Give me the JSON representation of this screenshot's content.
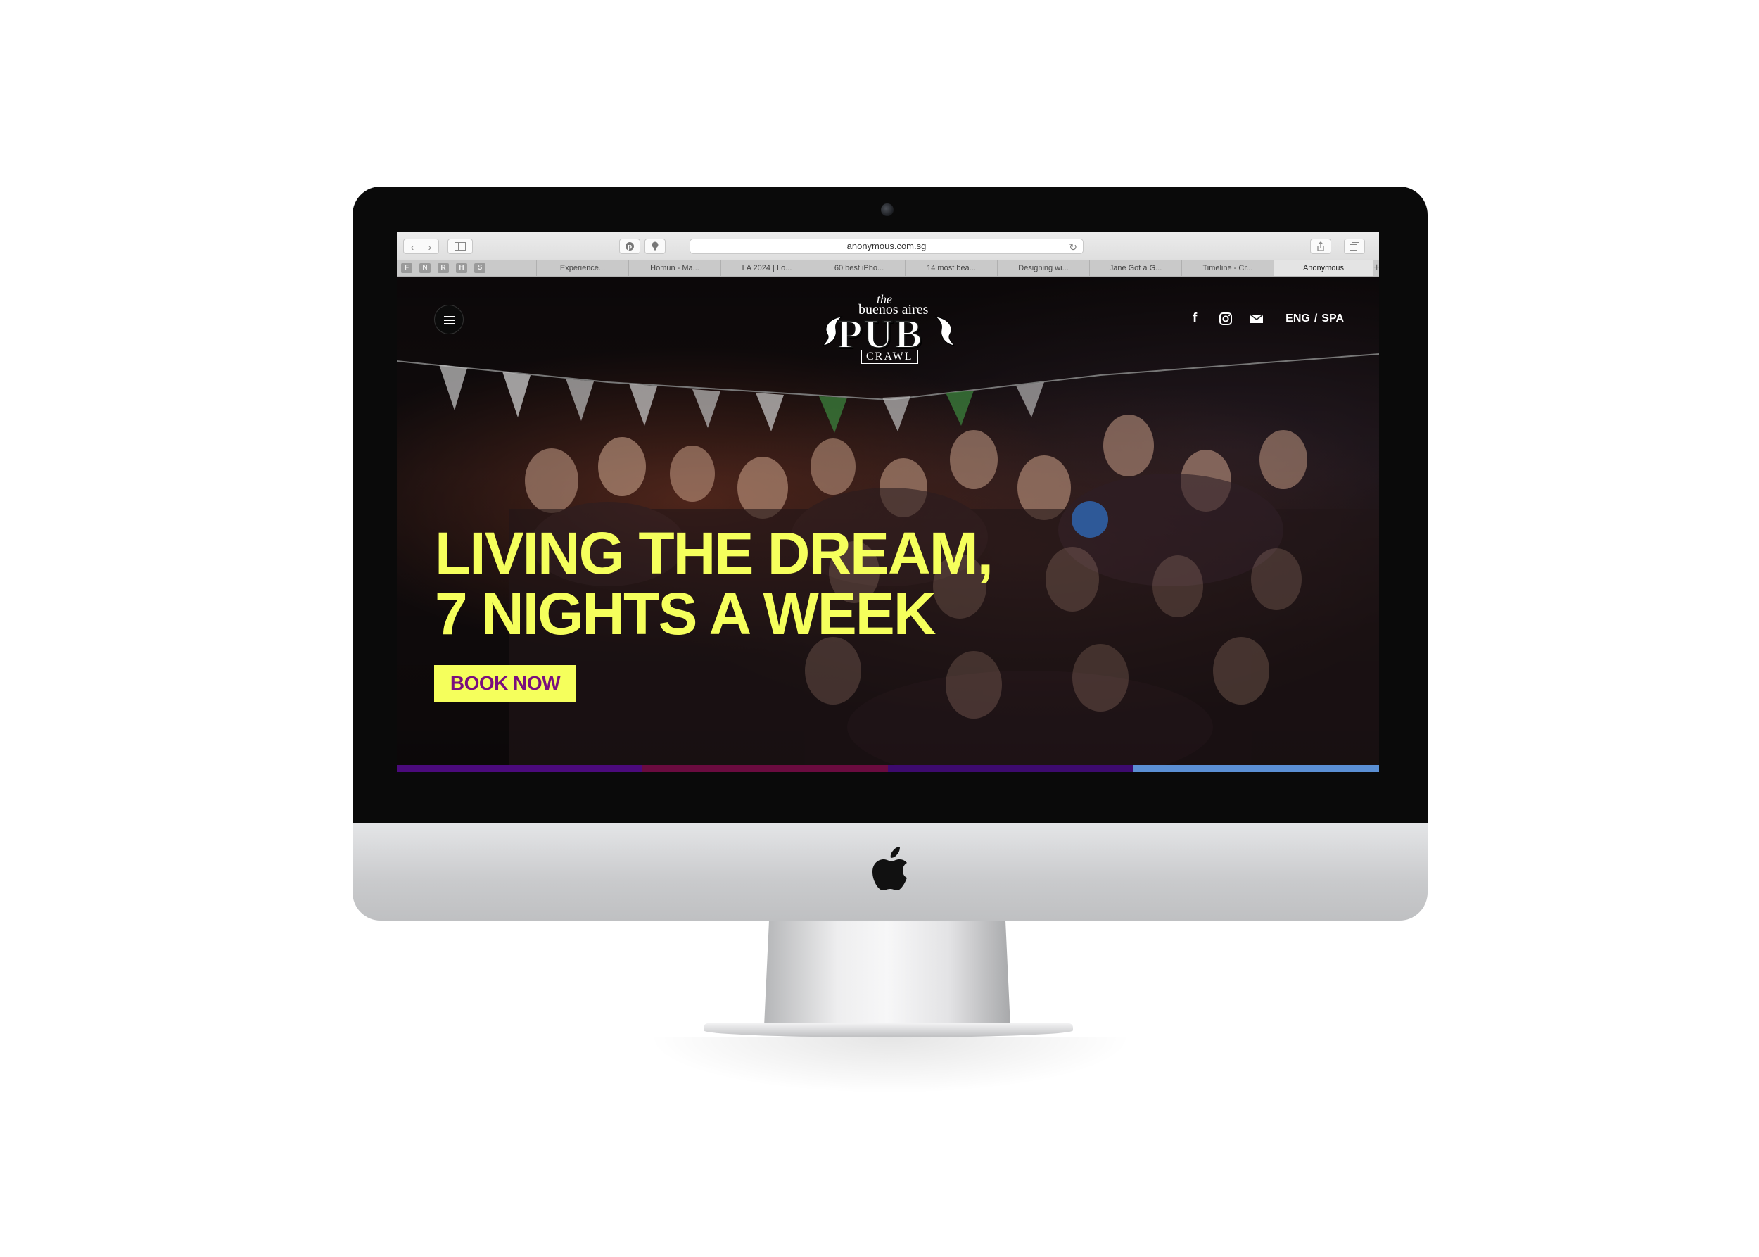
{
  "browser": {
    "url": "anonymous.com.sg",
    "pinned_tabs": [
      "F",
      "N",
      "R",
      "H",
      "S"
    ],
    "tabs": [
      {
        "label": "Experience...",
        "active": false
      },
      {
        "label": "Homun - Ma...",
        "active": false
      },
      {
        "label": "LA 2024 | Lo...",
        "active": false
      },
      {
        "label": "60 best iPho...",
        "active": false
      },
      {
        "label": "14 most bea...",
        "active": false
      },
      {
        "label": "Designing wi...",
        "active": false
      },
      {
        "label": "Jane Got a G...",
        "active": false
      },
      {
        "label": "Timeline - Cr...",
        "active": false
      },
      {
        "label": "Anonymous",
        "active": true
      }
    ],
    "new_tab_label": "+"
  },
  "site": {
    "logo": {
      "line1": "the",
      "line2": "buenos aires",
      "line3": "PUB",
      "line4": "CRAWL"
    },
    "lang": {
      "primary": "ENG",
      "separator": "/",
      "secondary": "SPA"
    },
    "social_icons": [
      "facebook-icon",
      "instagram-icon",
      "mail-icon"
    ]
  },
  "hero": {
    "headline_line1": "LIVING THE DREAM,",
    "headline_line2": "7 NIGHTS A WEEK",
    "cta_label": "BOOK NOW",
    "slides": 4,
    "active_slide": 4
  },
  "colors": {
    "headline": "#f5ff5c",
    "cta_background": "#f5ff5c",
    "cta_text": "#7a0f7e",
    "progress_segments": [
      "#4b0a7c",
      "#6a0b3f",
      "#3d0a6e",
      "#5b8fd4"
    ]
  }
}
